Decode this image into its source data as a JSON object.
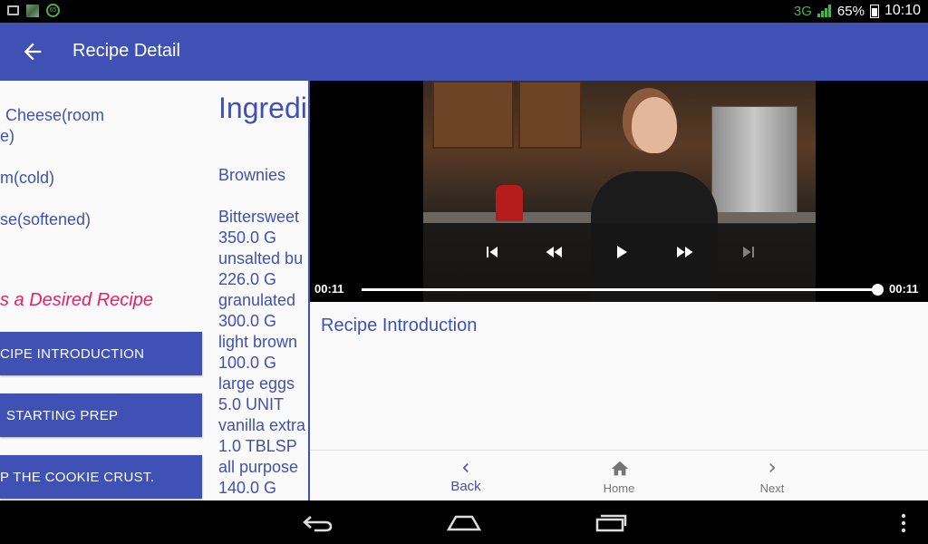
{
  "status_bar": {
    "network": "3G",
    "battery": "65%",
    "time": "10:10",
    "notification_icons": [
      "image-icon",
      "app-icon",
      "app65-icon"
    ]
  },
  "app_bar": {
    "title": "Recipe Detail",
    "back_icon": "arrow-left-icon",
    "color": "#3f51b5"
  },
  "left_column": {
    "ingredients_partial": [
      "Cheese(room",
      "e)",
      "m(cold)",
      "se(softened)"
    ],
    "desired_recipe_text": "s a Desired Recipe",
    "steps": [
      "CIPE INTRODUCTION",
      "STARTING PREP",
      "P THE COOKIE CRUST."
    ]
  },
  "middle_column": {
    "header": "Ingredi",
    "recipe_name": "Brownies",
    "items": [
      "Bittersweet",
      "350.0 G",
      "unsalted bu",
      "226.0 G",
      "granulated",
      "300.0 G",
      "light brown",
      "100.0 G",
      "large eggs",
      "5.0 UNIT",
      "vanilla extra",
      "1.0 TBLSP",
      "all purpose",
      "140.0 G"
    ]
  },
  "player": {
    "current_time": "00:11",
    "total_time": "00:11",
    "progress": 1.0,
    "controls": [
      "skip-previous-icon",
      "rewind-icon",
      "play-icon",
      "fast-forward-icon",
      "skip-next-icon"
    ]
  },
  "step_panel": {
    "title": "Recipe Introduction"
  },
  "bottom_nav": {
    "back": "Back",
    "home": "Home",
    "next": "Next"
  },
  "colors": {
    "primary": "#3f51b5",
    "accent": "#e91e63",
    "status_green": "#4caf50"
  }
}
